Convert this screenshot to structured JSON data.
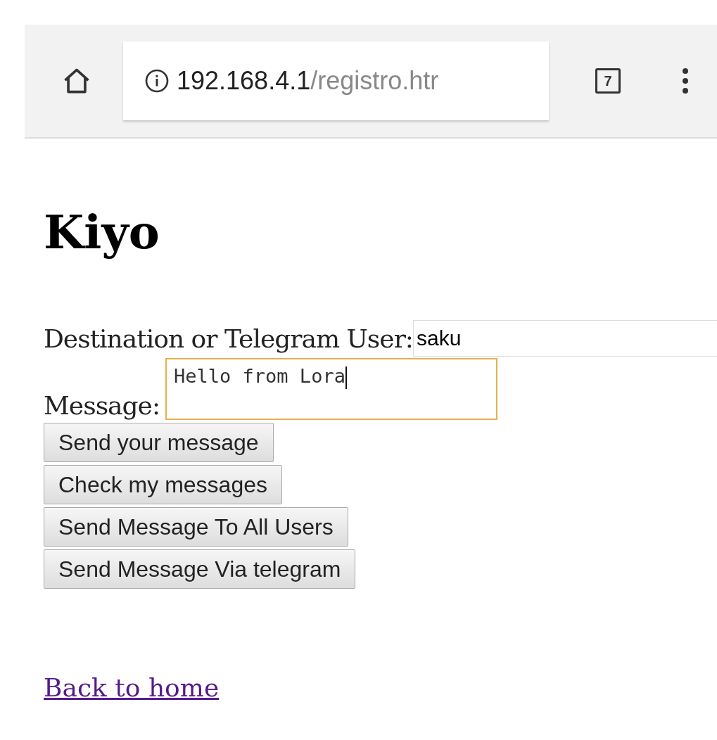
{
  "browser": {
    "url_host": "192.168.4.1",
    "url_path": "/registro.htr",
    "tab_count": "7"
  },
  "page": {
    "title": "Kiyo",
    "destination": {
      "label": "Destination or Telegram User:",
      "value": "saku"
    },
    "message": {
      "label": "Message:",
      "value": "Hello from Lora",
      "focused": true
    },
    "buttons": [
      "Send your message",
      "Check my messages",
      "Send Message To All Users",
      "Send Message Via telegram"
    ],
    "link": "Back to home"
  }
}
